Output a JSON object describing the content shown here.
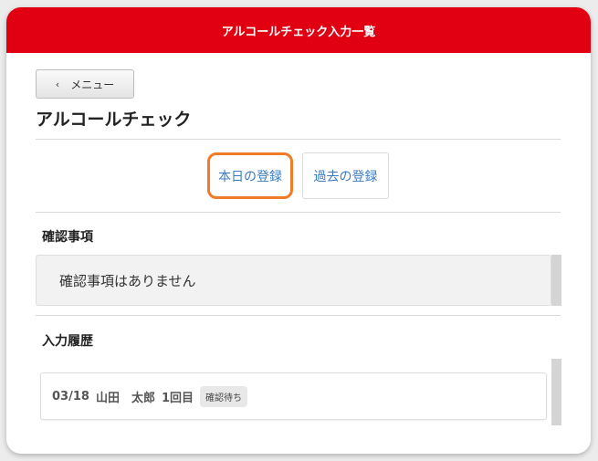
{
  "header": {
    "title": "アルコールチェック入力一覧"
  },
  "nav": {
    "back_label": "メニュー"
  },
  "page": {
    "title": "アルコールチェック"
  },
  "tabs": [
    {
      "label": "本日の登録",
      "selected": true
    },
    {
      "label": "過去の登録",
      "selected": false
    }
  ],
  "confirm": {
    "heading": "確認事項",
    "message": "確認事項はありません"
  },
  "history": {
    "heading": "入力履歴",
    "items": [
      {
        "date": "03/18",
        "name": "山田　太郎",
        "count": "1回目",
        "status": "確認待ち"
      }
    ]
  },
  "colors": {
    "header_bg": "#e00012",
    "selected_tab_border": "#f07b28",
    "tab_text": "#3a7bbf"
  },
  "icons": {
    "back": "chevron-left-icon"
  }
}
